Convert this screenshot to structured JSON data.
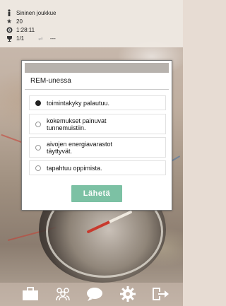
{
  "status": {
    "team_name": "Sininen joukkue",
    "score": "20",
    "time": "1:28:11",
    "progress": "1/1",
    "extra": "---"
  },
  "dialog": {
    "question": "REM-unessa",
    "options": [
      {
        "label": "toimintakyky palautuu.",
        "selected": true
      },
      {
        "label": "kokemukset painuvat tunnemuistiin.",
        "selected": false
      },
      {
        "label": "aivojen energiavarastot täyttyvät.",
        "selected": false
      },
      {
        "label": "tapahtuu oppimista.",
        "selected": false
      }
    ],
    "submit_label": "Lähetä"
  },
  "nav": {
    "items": [
      "briefcase-icon",
      "team-icon",
      "chat-icon",
      "settings-icon",
      "logout-icon"
    ]
  },
  "colors": {
    "submit_bg": "#7cc1a4",
    "nav_icon": "#ffffff"
  }
}
